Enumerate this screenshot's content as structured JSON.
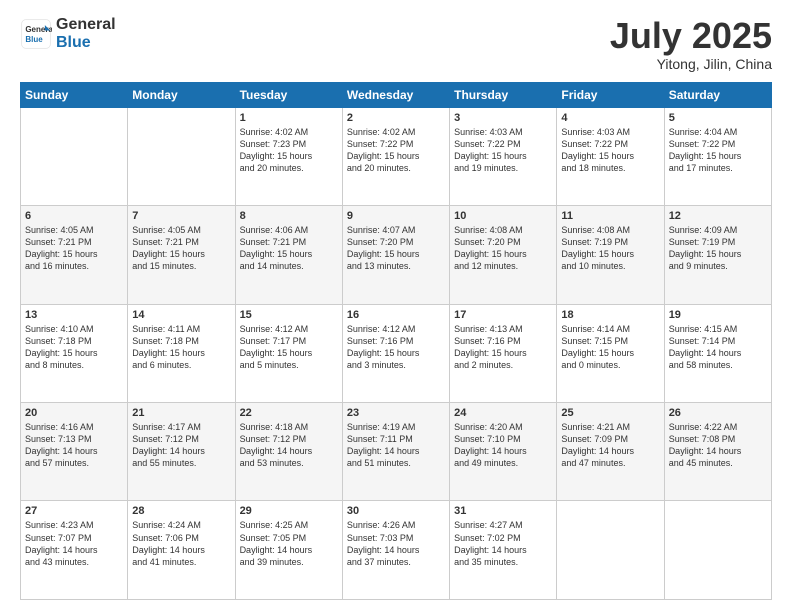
{
  "header": {
    "logo_general": "General",
    "logo_blue": "Blue",
    "month": "July 2025",
    "location": "Yitong, Jilin, China"
  },
  "weekdays": [
    "Sunday",
    "Monday",
    "Tuesday",
    "Wednesday",
    "Thursday",
    "Friday",
    "Saturday"
  ],
  "weeks": [
    [
      {
        "day": "",
        "info": ""
      },
      {
        "day": "",
        "info": ""
      },
      {
        "day": "1",
        "info": "Sunrise: 4:02 AM\nSunset: 7:23 PM\nDaylight: 15 hours\nand 20 minutes."
      },
      {
        "day": "2",
        "info": "Sunrise: 4:02 AM\nSunset: 7:22 PM\nDaylight: 15 hours\nand 20 minutes."
      },
      {
        "day": "3",
        "info": "Sunrise: 4:03 AM\nSunset: 7:22 PM\nDaylight: 15 hours\nand 19 minutes."
      },
      {
        "day": "4",
        "info": "Sunrise: 4:03 AM\nSunset: 7:22 PM\nDaylight: 15 hours\nand 18 minutes."
      },
      {
        "day": "5",
        "info": "Sunrise: 4:04 AM\nSunset: 7:22 PM\nDaylight: 15 hours\nand 17 minutes."
      }
    ],
    [
      {
        "day": "6",
        "info": "Sunrise: 4:05 AM\nSunset: 7:21 PM\nDaylight: 15 hours\nand 16 minutes."
      },
      {
        "day": "7",
        "info": "Sunrise: 4:05 AM\nSunset: 7:21 PM\nDaylight: 15 hours\nand 15 minutes."
      },
      {
        "day": "8",
        "info": "Sunrise: 4:06 AM\nSunset: 7:21 PM\nDaylight: 15 hours\nand 14 minutes."
      },
      {
        "day": "9",
        "info": "Sunrise: 4:07 AM\nSunset: 7:20 PM\nDaylight: 15 hours\nand 13 minutes."
      },
      {
        "day": "10",
        "info": "Sunrise: 4:08 AM\nSunset: 7:20 PM\nDaylight: 15 hours\nand 12 minutes."
      },
      {
        "day": "11",
        "info": "Sunrise: 4:08 AM\nSunset: 7:19 PM\nDaylight: 15 hours\nand 10 minutes."
      },
      {
        "day": "12",
        "info": "Sunrise: 4:09 AM\nSunset: 7:19 PM\nDaylight: 15 hours\nand 9 minutes."
      }
    ],
    [
      {
        "day": "13",
        "info": "Sunrise: 4:10 AM\nSunset: 7:18 PM\nDaylight: 15 hours\nand 8 minutes."
      },
      {
        "day": "14",
        "info": "Sunrise: 4:11 AM\nSunset: 7:18 PM\nDaylight: 15 hours\nand 6 minutes."
      },
      {
        "day": "15",
        "info": "Sunrise: 4:12 AM\nSunset: 7:17 PM\nDaylight: 15 hours\nand 5 minutes."
      },
      {
        "day": "16",
        "info": "Sunrise: 4:12 AM\nSunset: 7:16 PM\nDaylight: 15 hours\nand 3 minutes."
      },
      {
        "day": "17",
        "info": "Sunrise: 4:13 AM\nSunset: 7:16 PM\nDaylight: 15 hours\nand 2 minutes."
      },
      {
        "day": "18",
        "info": "Sunrise: 4:14 AM\nSunset: 7:15 PM\nDaylight: 15 hours\nand 0 minutes."
      },
      {
        "day": "19",
        "info": "Sunrise: 4:15 AM\nSunset: 7:14 PM\nDaylight: 14 hours\nand 58 minutes."
      }
    ],
    [
      {
        "day": "20",
        "info": "Sunrise: 4:16 AM\nSunset: 7:13 PM\nDaylight: 14 hours\nand 57 minutes."
      },
      {
        "day": "21",
        "info": "Sunrise: 4:17 AM\nSunset: 7:12 PM\nDaylight: 14 hours\nand 55 minutes."
      },
      {
        "day": "22",
        "info": "Sunrise: 4:18 AM\nSunset: 7:12 PM\nDaylight: 14 hours\nand 53 minutes."
      },
      {
        "day": "23",
        "info": "Sunrise: 4:19 AM\nSunset: 7:11 PM\nDaylight: 14 hours\nand 51 minutes."
      },
      {
        "day": "24",
        "info": "Sunrise: 4:20 AM\nSunset: 7:10 PM\nDaylight: 14 hours\nand 49 minutes."
      },
      {
        "day": "25",
        "info": "Sunrise: 4:21 AM\nSunset: 7:09 PM\nDaylight: 14 hours\nand 47 minutes."
      },
      {
        "day": "26",
        "info": "Sunrise: 4:22 AM\nSunset: 7:08 PM\nDaylight: 14 hours\nand 45 minutes."
      }
    ],
    [
      {
        "day": "27",
        "info": "Sunrise: 4:23 AM\nSunset: 7:07 PM\nDaylight: 14 hours\nand 43 minutes."
      },
      {
        "day": "28",
        "info": "Sunrise: 4:24 AM\nSunset: 7:06 PM\nDaylight: 14 hours\nand 41 minutes."
      },
      {
        "day": "29",
        "info": "Sunrise: 4:25 AM\nSunset: 7:05 PM\nDaylight: 14 hours\nand 39 minutes."
      },
      {
        "day": "30",
        "info": "Sunrise: 4:26 AM\nSunset: 7:03 PM\nDaylight: 14 hours\nand 37 minutes."
      },
      {
        "day": "31",
        "info": "Sunrise: 4:27 AM\nSunset: 7:02 PM\nDaylight: 14 hours\nand 35 minutes."
      },
      {
        "day": "",
        "info": ""
      },
      {
        "day": "",
        "info": ""
      }
    ]
  ]
}
